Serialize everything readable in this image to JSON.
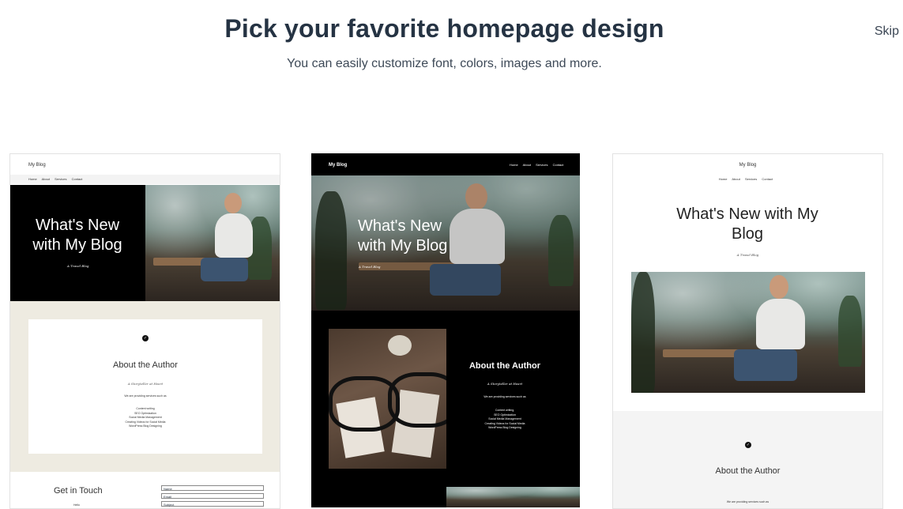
{
  "header": {
    "title": "Pick your favorite homepage design",
    "subtitle": "You can easily customize font, colors, images and more.",
    "skip_label": "Skip"
  },
  "cards": [
    {
      "blog_name": "My Blog",
      "nav": [
        "Home",
        "About",
        "Services",
        "Contact"
      ],
      "hero_title": "What's New with My Blog",
      "hero_tagline": "A Travel Blog",
      "about": {
        "title": "About the Author",
        "tagline": "A Storyteller at Heart",
        "intro": "We are providing services such as",
        "services": [
          "Content writing",
          "SEO Optimization",
          "Social Media Management",
          "Creating Videos for Social Media",
          "WordPress Blog Designing"
        ]
      },
      "contact": {
        "title": "Get in Touch",
        "hello": "Hello",
        "fields": [
          "Name",
          "Email",
          "Subject"
        ]
      }
    },
    {
      "blog_name": "My Blog",
      "nav": [
        "Home",
        "About",
        "Services",
        "Contact"
      ],
      "hero_title": "What's New with My Blog",
      "hero_tagline": "A Travel Blog",
      "about": {
        "title": "About the Author",
        "tagline": "A Storyteller at Heart",
        "intro": "We are providing services such as",
        "services": [
          "Content writing,",
          "SEO Optimization",
          "Social Media Management",
          "Creating Videos for Social Media",
          "WordPress Blog Designing"
        ]
      }
    },
    {
      "blog_name": "My Blog",
      "nav": [
        "Home",
        "About",
        "Services",
        "Contact"
      ],
      "hero_title": "What's New with My Blog",
      "hero_tagline": "A Travel Blog",
      "about": {
        "title": "About the Author",
        "intro": "We are providing services such as"
      }
    }
  ]
}
